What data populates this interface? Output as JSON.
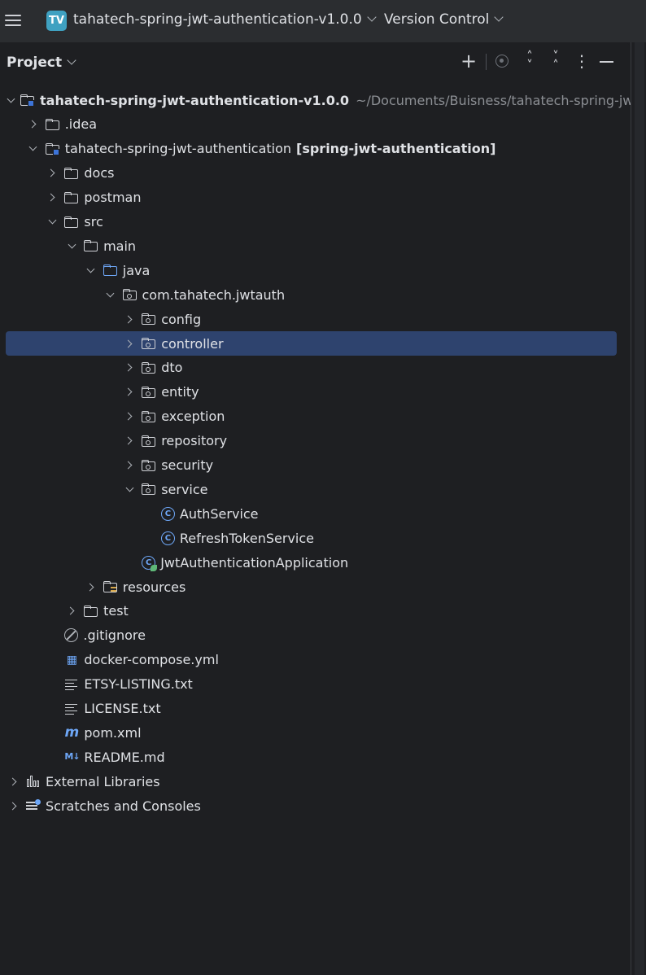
{
  "topbar": {
    "project_badge": "TV",
    "project_name": "tahatech-spring-jwt-authentication-v1.0.0",
    "vcs_label": "Version Control"
  },
  "panel": {
    "title": "Project"
  },
  "tree": [
    {
      "text": "tahatech-spring-jwt-authentication-v1.0.0",
      "suffix": "",
      "muted": "~/Documents/Buisness/tahatech-spring-jwt-auth",
      "level": 0,
      "arrow": "down",
      "icon": "module-folder-icon",
      "bold": true
    },
    {
      "text": ".idea",
      "level": 1,
      "arrow": "right",
      "icon": "folder-icon"
    },
    {
      "text": "tahatech-spring-jwt-authentication",
      "suffix": "[spring-jwt-authentication]",
      "level": 1,
      "arrow": "down",
      "icon": "module-folder-icon"
    },
    {
      "text": "docs",
      "level": 2,
      "arrow": "right",
      "icon": "folder-icon"
    },
    {
      "text": "postman",
      "level": 2,
      "arrow": "right",
      "icon": "folder-icon"
    },
    {
      "text": "src",
      "level": 2,
      "arrow": "down",
      "icon": "folder-icon"
    },
    {
      "text": "main",
      "level": 3,
      "arrow": "down",
      "icon": "folder-icon"
    },
    {
      "text": "java",
      "level": 4,
      "arrow": "down",
      "icon": "source-folder-icon"
    },
    {
      "text": "com.tahatech.jwtauth",
      "level": 5,
      "arrow": "down",
      "icon": "package-icon"
    },
    {
      "text": "config",
      "level": 6,
      "arrow": "right",
      "icon": "package-icon"
    },
    {
      "text": "controller",
      "level": 6,
      "arrow": "right",
      "icon": "package-icon",
      "selected": true
    },
    {
      "text": "dto",
      "level": 6,
      "arrow": "right",
      "icon": "package-icon"
    },
    {
      "text": "entity",
      "level": 6,
      "arrow": "right",
      "icon": "package-icon"
    },
    {
      "text": "exception",
      "level": 6,
      "arrow": "right",
      "icon": "package-icon"
    },
    {
      "text": "repository",
      "level": 6,
      "arrow": "right",
      "icon": "package-icon"
    },
    {
      "text": "security",
      "level": 6,
      "arrow": "right",
      "icon": "package-icon"
    },
    {
      "text": "service",
      "level": 6,
      "arrow": "down",
      "icon": "package-icon"
    },
    {
      "text": "AuthService",
      "level": 7,
      "arrow": "none",
      "icon": "class-icon"
    },
    {
      "text": "RefreshTokenService",
      "level": 7,
      "arrow": "none",
      "icon": "class-icon"
    },
    {
      "text": "JwtAuthenticationApplication",
      "level": 6,
      "arrow": "none",
      "icon": "spring-boot-app-icon"
    },
    {
      "text": "resources",
      "level": 4,
      "arrow": "right",
      "icon": "resources-folder-icon"
    },
    {
      "text": "test",
      "level": 3,
      "arrow": "right",
      "icon": "folder-icon"
    },
    {
      "text": ".gitignore",
      "level": 2,
      "arrow": "none",
      "icon": "gitignore-icon"
    },
    {
      "text": "docker-compose.yml",
      "level": 2,
      "arrow": "none",
      "icon": "docker-icon"
    },
    {
      "text": "ETSY-LISTING.txt",
      "level": 2,
      "arrow": "none",
      "icon": "text-file-icon"
    },
    {
      "text": "LICENSE.txt",
      "level": 2,
      "arrow": "none",
      "icon": "text-file-icon"
    },
    {
      "text": "pom.xml",
      "level": 2,
      "arrow": "none",
      "icon": "maven-icon"
    },
    {
      "text": "README.md",
      "level": 2,
      "arrow": "none",
      "icon": "markdown-icon"
    },
    {
      "text": "External Libraries",
      "level": 0,
      "arrow": "right",
      "icon": "libraries-icon"
    },
    {
      "text": "Scratches and Consoles",
      "level": 0,
      "arrow": "right",
      "icon": "scratches-icon"
    }
  ]
}
